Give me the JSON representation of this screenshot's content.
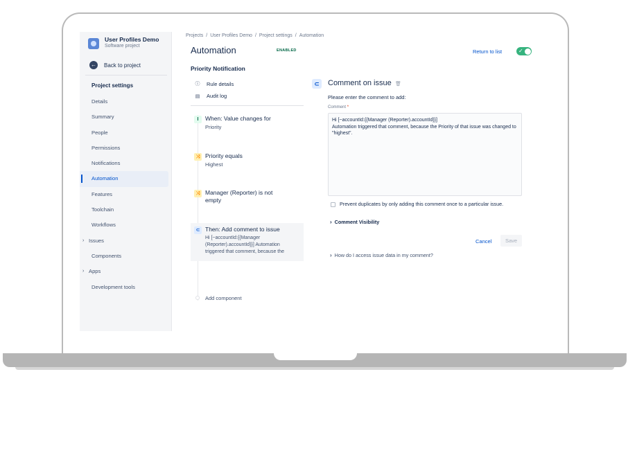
{
  "project": {
    "name": "User Profiles Demo",
    "type": "Software project"
  },
  "sidebar": {
    "back_label": "Back to project",
    "section_title": "Project settings",
    "items": [
      {
        "label": "Details",
        "chevron": ""
      },
      {
        "label": "Summary",
        "chevron": ""
      },
      {
        "label": "People",
        "chevron": ""
      },
      {
        "label": "Permissions",
        "chevron": ""
      },
      {
        "label": "Notifications",
        "chevron": ""
      },
      {
        "label": "Automation",
        "chevron": "",
        "active": true
      },
      {
        "label": "Features",
        "chevron": ""
      },
      {
        "label": "Toolchain",
        "chevron": ""
      },
      {
        "label": "Workflows",
        "chevron": ""
      },
      {
        "label": "Issues",
        "chevron": "›"
      },
      {
        "label": "Components",
        "chevron": ""
      },
      {
        "label": "Apps",
        "chevron": "›"
      },
      {
        "label": "Development tools",
        "chevron": ""
      }
    ]
  },
  "breadcrumb": [
    "Projects",
    "User Profiles Demo",
    "Project settings",
    "Automation"
  ],
  "header": {
    "title": "Automation",
    "status_badge": "ENABLED",
    "return_link": "Return to list",
    "toggle_on": true,
    "toggle_check": "✓"
  },
  "rule": {
    "name": "Priority Notification",
    "links": [
      {
        "label": "Rule details",
        "icon": "info-icon",
        "glyph": "ⓘ"
      },
      {
        "label": "Audit log",
        "icon": "document-icon",
        "glyph": "▤"
      }
    ],
    "steps": [
      {
        "title": "When: Value changes for",
        "subtitle": "Priority",
        "icon": "trigger-icon",
        "glyph": "I",
        "color": "green"
      },
      {
        "title": "Priority equals",
        "subtitle": "Highest",
        "icon": "condition-icon",
        "glyph": "⤨",
        "color": "yellow"
      },
      {
        "title": "Manager (Reporter) is not empty",
        "subtitle": "",
        "icon": "condition-icon",
        "glyph": "⤨",
        "color": "yellow"
      },
      {
        "title": "Then: Add comment to issue",
        "subtitle": "Hi [~accountId:{{Manager (Reporter).accountId}}] Automation triggered that comment, because the",
        "icon": "comment-action-icon",
        "glyph": "⊂",
        "color": "blue",
        "selected": true
      }
    ],
    "add_component": "Add component"
  },
  "panel": {
    "title": "Comment on issue",
    "trash_glyph": "🗑",
    "icon_glyph": "⊂",
    "prompt": "Please enter the comment to add:",
    "field_label": "Comment",
    "required_mark": "*",
    "comment_value": "Hi [~accountId:{{Manager (Reporter).accountId}}]\nAutomation triggered that comment, because the Priority of that issue was changed to \"highest\".",
    "prevent_duplicates": "Prevent duplicates by only adding this comment once to a particular issue.",
    "prevent_checked": false,
    "visibility_label": "Comment Visibility",
    "cancel_label": "Cancel",
    "save_label": "Save",
    "help_link": "How do I access issue data in my comment?"
  }
}
